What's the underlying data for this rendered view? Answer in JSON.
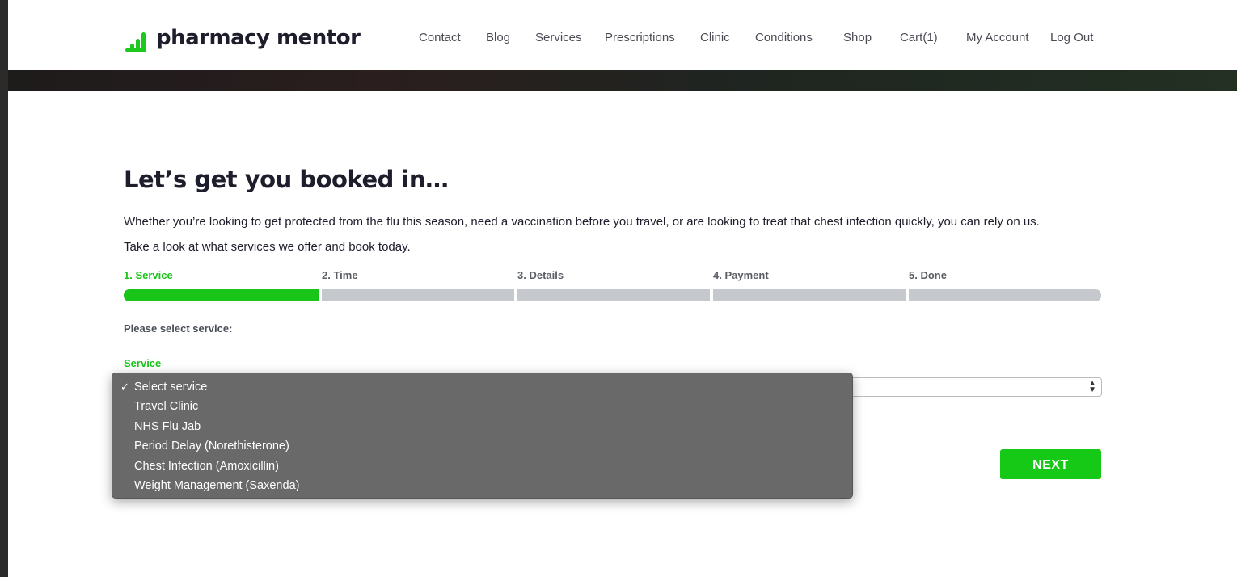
{
  "header": {
    "logo_text": "pharmacy mentor",
    "nav": [
      {
        "label": "Contact",
        "name": "nav-contact"
      },
      {
        "label": "Blog",
        "name": "nav-blog"
      },
      {
        "label": "Services",
        "name": "nav-services"
      },
      {
        "label": "Prescriptions",
        "name": "nav-prescriptions"
      },
      {
        "label": "Clinic",
        "name": "nav-clinic"
      },
      {
        "label": "Conditions",
        "name": "nav-conditions"
      },
      {
        "label": "Shop",
        "name": "nav-shop"
      },
      {
        "label": "Cart(1)",
        "name": "nav-cart"
      },
      {
        "label": "My Account",
        "name": "nav-my-account"
      },
      {
        "label": "Log Out",
        "name": "nav-log-out"
      }
    ]
  },
  "main": {
    "title": "Let’s get you booked in…",
    "intro_line1": "Whether you’re looking to get protected from the flu this season, need a vaccination before you travel, or are looking to treat that chest infection quickly, you can rely on us.",
    "intro_line2": "Take a look at what services we offer and book today.",
    "steps": [
      {
        "label": "1. Service",
        "active": true
      },
      {
        "label": "2. Time",
        "active": false
      },
      {
        "label": "3. Details",
        "active": false
      },
      {
        "label": "4. Payment",
        "active": false
      },
      {
        "label": "5. Done",
        "active": false
      }
    ],
    "please_select": "Please select service:",
    "service_label": "Service",
    "next_label": "NEXT"
  },
  "dropdown": {
    "selected_value": "Select service",
    "options": [
      "Select service",
      "Travel Clinic",
      "NHS Flu Jab",
      "Period Delay (Norethisterone)",
      "Chest Infection (Amoxicillin)",
      "Weight Management (Saxenda)"
    ]
  },
  "colors": {
    "accent_green": "#18c518",
    "inactive_bar": "#c5c8cc",
    "text_dark": "#1d1d2b"
  }
}
